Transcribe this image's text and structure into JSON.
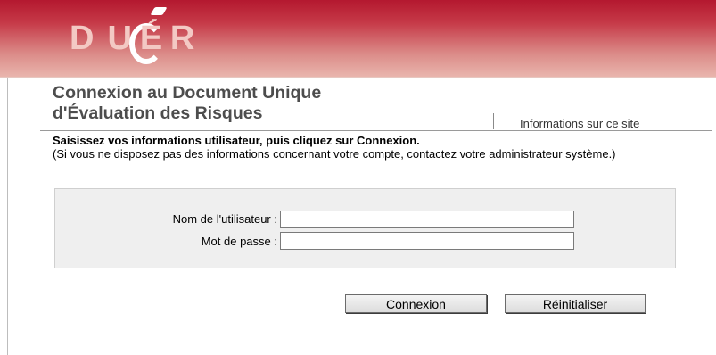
{
  "header": {
    "logo_letters": [
      "D",
      "U",
      "É",
      "R"
    ]
  },
  "page": {
    "title_line1": "Connexion au Document Unique",
    "title_line2": "d'Évaluation des Risques",
    "info_link": "Informations sur ce site"
  },
  "instructions": {
    "main": "Saisissez vos informations utilisateur, puis cliquez sur Connexion.",
    "note": "(Si vous ne disposez pas des informations concernant votre compte, contactez votre administrateur système.)"
  },
  "form": {
    "username_label": "Nom de l'utilisateur :",
    "username_value": "",
    "password_label": "Mot de passe :",
    "password_value": ""
  },
  "buttons": {
    "connect": "Connexion",
    "reset": "Réinitialiser"
  },
  "colors": {
    "header_red": "#b4182f",
    "header_light": "#e9b5ad",
    "title_gray": "#4d4d4d",
    "form_bg": "#efefef"
  }
}
